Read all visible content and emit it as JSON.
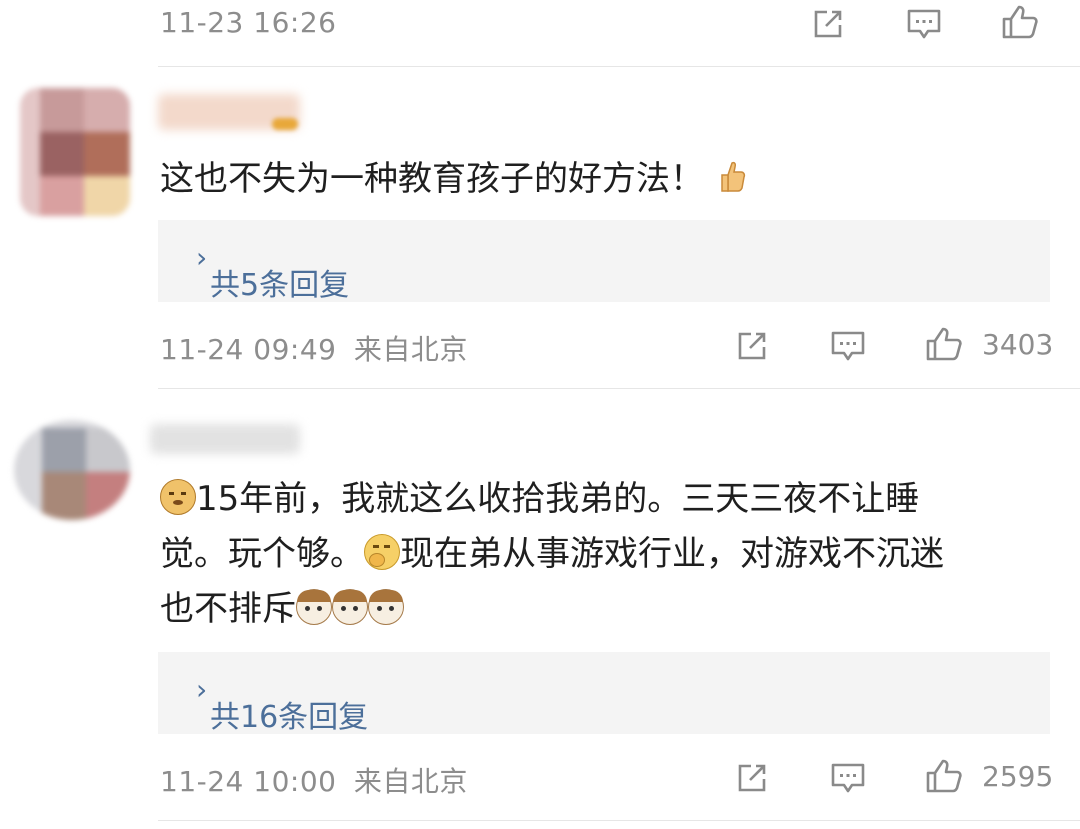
{
  "comment0": {
    "time": "11-23 16:26"
  },
  "comment1": {
    "text": "这也不失为一种教育孩子的好方法！",
    "emoji_trailing": "thumbs-up-emoji",
    "reply_label": "共5条回复",
    "time": "11-24 09:49",
    "location": "来自北京",
    "likes": "3403"
  },
  "comment2": {
    "line1": "15年前，我就这么收拾我弟的。三天三夜不让睡",
    "line2a": "觉。玩个够。",
    "line2b": "现在弟从事游戏行业，对游戏不沉迷",
    "line3": "也不排斥",
    "reply_label": "共16条回复",
    "time": "11-24 10:00",
    "location": "来自北京",
    "likes": "2595"
  },
  "icons": [
    "share-icon",
    "comment-icon",
    "like-icon",
    "chevron-right-icon"
  ],
  "colors": {
    "link": "#4c6f9a",
    "meta": "#8d8d8d",
    "reply_bg": "#f4f4f4"
  }
}
